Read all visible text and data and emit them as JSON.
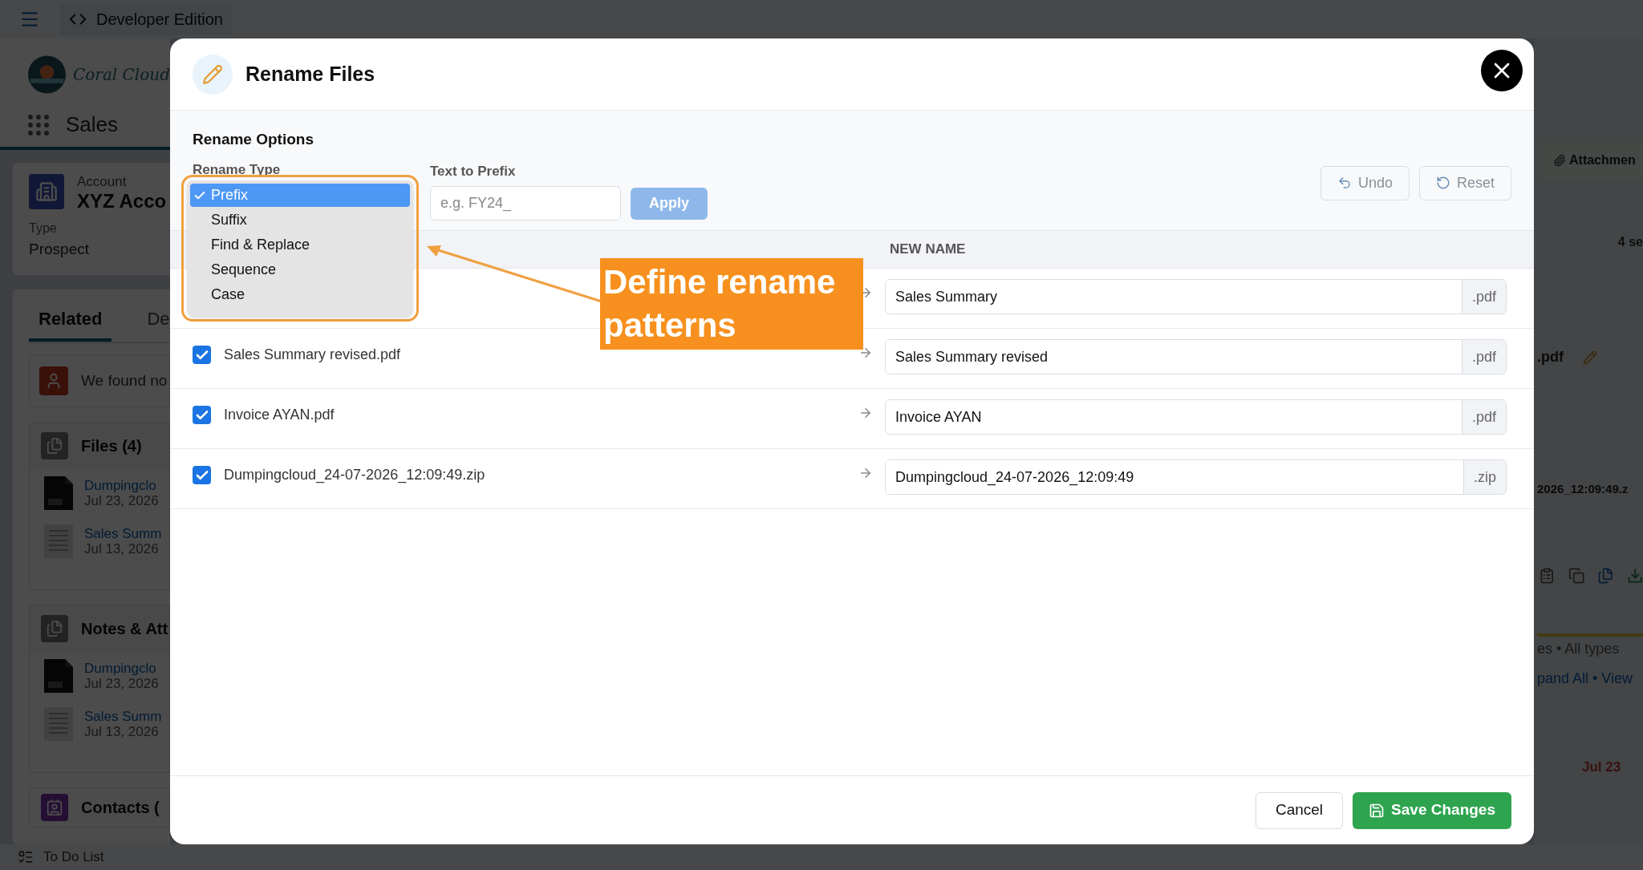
{
  "background": {
    "top_bar": {
      "edition": "Developer Edition"
    },
    "app_logo_text": "Coral Cloud",
    "app_name": "Sales",
    "record": {
      "object": "Account",
      "name": "XYZ Acco",
      "field_label": "Type",
      "field_value": "Prospect"
    },
    "tabs": [
      {
        "label": "Related",
        "selected": true
      },
      {
        "label": "De",
        "selected": false
      }
    ],
    "notice": "We found no",
    "cards": [
      {
        "title": "Files (4)",
        "items": [
          {
            "name": "Dumpingclo",
            "date": "Jul 23, 2026",
            "kind": "zip"
          },
          {
            "name": "Sales Summ",
            "date": "Jul 13, 2026",
            "kind": "doc"
          }
        ]
      },
      {
        "title": "Notes & Att",
        "items": [
          {
            "name": "Dumpingclo",
            "date": "Jul 23, 2026",
            "kind": "zip"
          },
          {
            "name": "Sales Summ",
            "date": "Jul 13, 2026",
            "kind": "doc"
          }
        ]
      }
    ],
    "contacts_title": "Contacts (",
    "right_panel": {
      "tab": "Attachmen",
      "count": "4 se",
      "row_1": ".pdf",
      "row_2": "2026_12:09:49.z",
      "filter": "es • All types",
      "links": "pand All • View",
      "due": "Jul 23"
    },
    "footer": "To Do List"
  },
  "dialog": {
    "title": "Rename Files",
    "section_title": "Rename Options",
    "rename_type": {
      "label": "Rename Type",
      "options": [
        {
          "label": "Prefix",
          "selected": true
        },
        {
          "label": "Suffix",
          "selected": false
        },
        {
          "label": "Find & Replace",
          "selected": false
        },
        {
          "label": "Sequence",
          "selected": false
        },
        {
          "label": "Case",
          "selected": false
        }
      ]
    },
    "text_field": {
      "label": "Text to Prefix",
      "placeholder": "e.g. FY24_"
    },
    "apply": {
      "label": "Apply",
      "disabled": true
    },
    "undo": {
      "label": "Undo",
      "disabled": true
    },
    "reset": {
      "label": "Reset",
      "disabled": true
    },
    "column_new_name": "NEW NAME",
    "rows": [
      {
        "new_name": "Sales Summary",
        "extension": ".pdf"
      },
      {
        "checked": true,
        "original": "Sales Summary revised.pdf",
        "new_name": "Sales Summary revised",
        "extension": ".pdf"
      },
      {
        "checked": true,
        "original": "Invoice AYAN.pdf",
        "new_name": "Invoice AYAN",
        "extension": ".pdf"
      },
      {
        "checked": true,
        "original": "Dumpingcloud_24-07-2026_12:09:49.zip",
        "new_name": "Dumpingcloud_24-07-2026_12:09:49",
        "extension": ".zip"
      }
    ],
    "cancel": "Cancel",
    "save": "Save Changes"
  },
  "annotation": {
    "text": "Define rename patterns"
  }
}
